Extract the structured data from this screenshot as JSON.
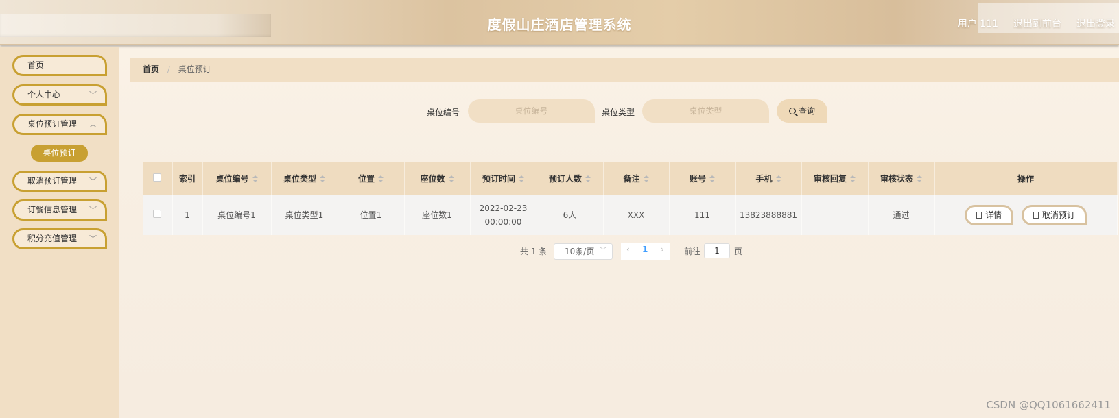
{
  "header": {
    "title": "度假山庄酒店管理系统",
    "user": "用户 111",
    "exit_front": "退出到前台",
    "logout": "退出登录"
  },
  "sidebar": {
    "items": [
      {
        "label": "首页",
        "has_arrow": false
      },
      {
        "label": "个人中心",
        "has_arrow": true
      },
      {
        "label": "桌位预订管理",
        "has_arrow": true
      },
      {
        "label": "取消预订管理",
        "has_arrow": true
      },
      {
        "label": "订餐信息管理",
        "has_arrow": true
      },
      {
        "label": "积分充值管理",
        "has_arrow": true
      }
    ],
    "active_sub": "桌位预订"
  },
  "breadcrumb": {
    "home": "首页",
    "current": "桌位预订"
  },
  "search": {
    "field1_label": "桌位编号",
    "field1_placeholder": "桌位编号",
    "field2_label": "桌位类型",
    "field2_placeholder": "桌位类型",
    "query_label": "查询"
  },
  "table": {
    "headers": [
      "索引",
      "桌位编号",
      "桌位类型",
      "位置",
      "座位数",
      "预订时间",
      "预订人数",
      "备注",
      "账号",
      "手机",
      "审核回复",
      "审核状态",
      "操作"
    ],
    "row": {
      "index": "1",
      "table_no": "桌位编号1",
      "table_type": "桌位类型1",
      "position": "位置1",
      "seats": "座位数1",
      "time": "2022-02-23 00:00:00",
      "people": "6人",
      "remark": "XXX",
      "account": "111",
      "phone": "13823888881",
      "reply": "",
      "status": "通过",
      "detail_btn": "详情",
      "cancel_btn": "取消预订"
    }
  },
  "pager": {
    "total": "共 1 条",
    "page_size": "10条/页",
    "current_page": "1",
    "goto": "前往",
    "goto_value": "1",
    "page_unit": "页"
  },
  "watermark": "CSDN @QQ1061662411"
}
